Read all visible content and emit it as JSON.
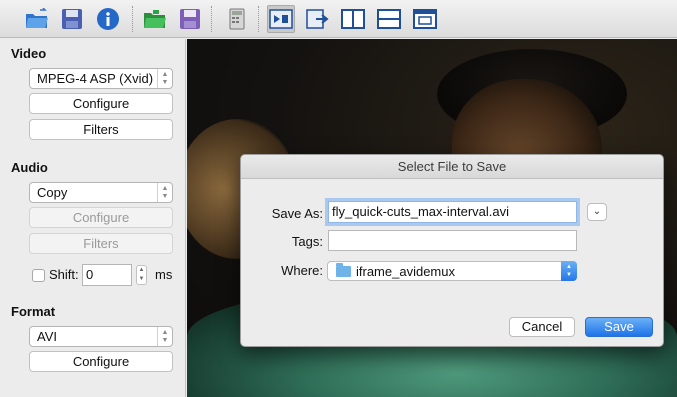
{
  "toolbar": {
    "icons": [
      "open-folder-icon",
      "save-disk-icon",
      "info-icon",
      "open-folder-green-icon",
      "save-disk-icon",
      "calculator-icon",
      "input-to-output-icon",
      "output-icon",
      "split-vertical-icon",
      "split-horizontal-icon",
      "window-icon"
    ],
    "colors": {
      "blue": "#2b6cc4",
      "green": "#2aa245",
      "purple": "#7d5fb8"
    }
  },
  "left_panel": {
    "video": {
      "label": "Video",
      "codec": "MPEG-4 ASP (Xvid)",
      "configure": "Configure",
      "filters": "Filters"
    },
    "audio": {
      "label": "Audio",
      "codec": "Copy",
      "configure": "Configure",
      "filters": "Filters",
      "shift_label": "Shift:",
      "shift_value": "0",
      "shift_unit": "ms"
    },
    "format": {
      "label": "Format",
      "container": "AVI",
      "configure": "Configure"
    }
  },
  "dialog": {
    "title": "Select File to Save",
    "save_as_label": "Save As:",
    "save_as_value": "fly_quick-cuts_max-interval.avi",
    "tags_label": "Tags:",
    "tags_value": "",
    "where_label": "Where:",
    "where_value": "iframe_avidemux",
    "cancel": "Cancel",
    "save": "Save",
    "accent_color": "#2477e6"
  }
}
